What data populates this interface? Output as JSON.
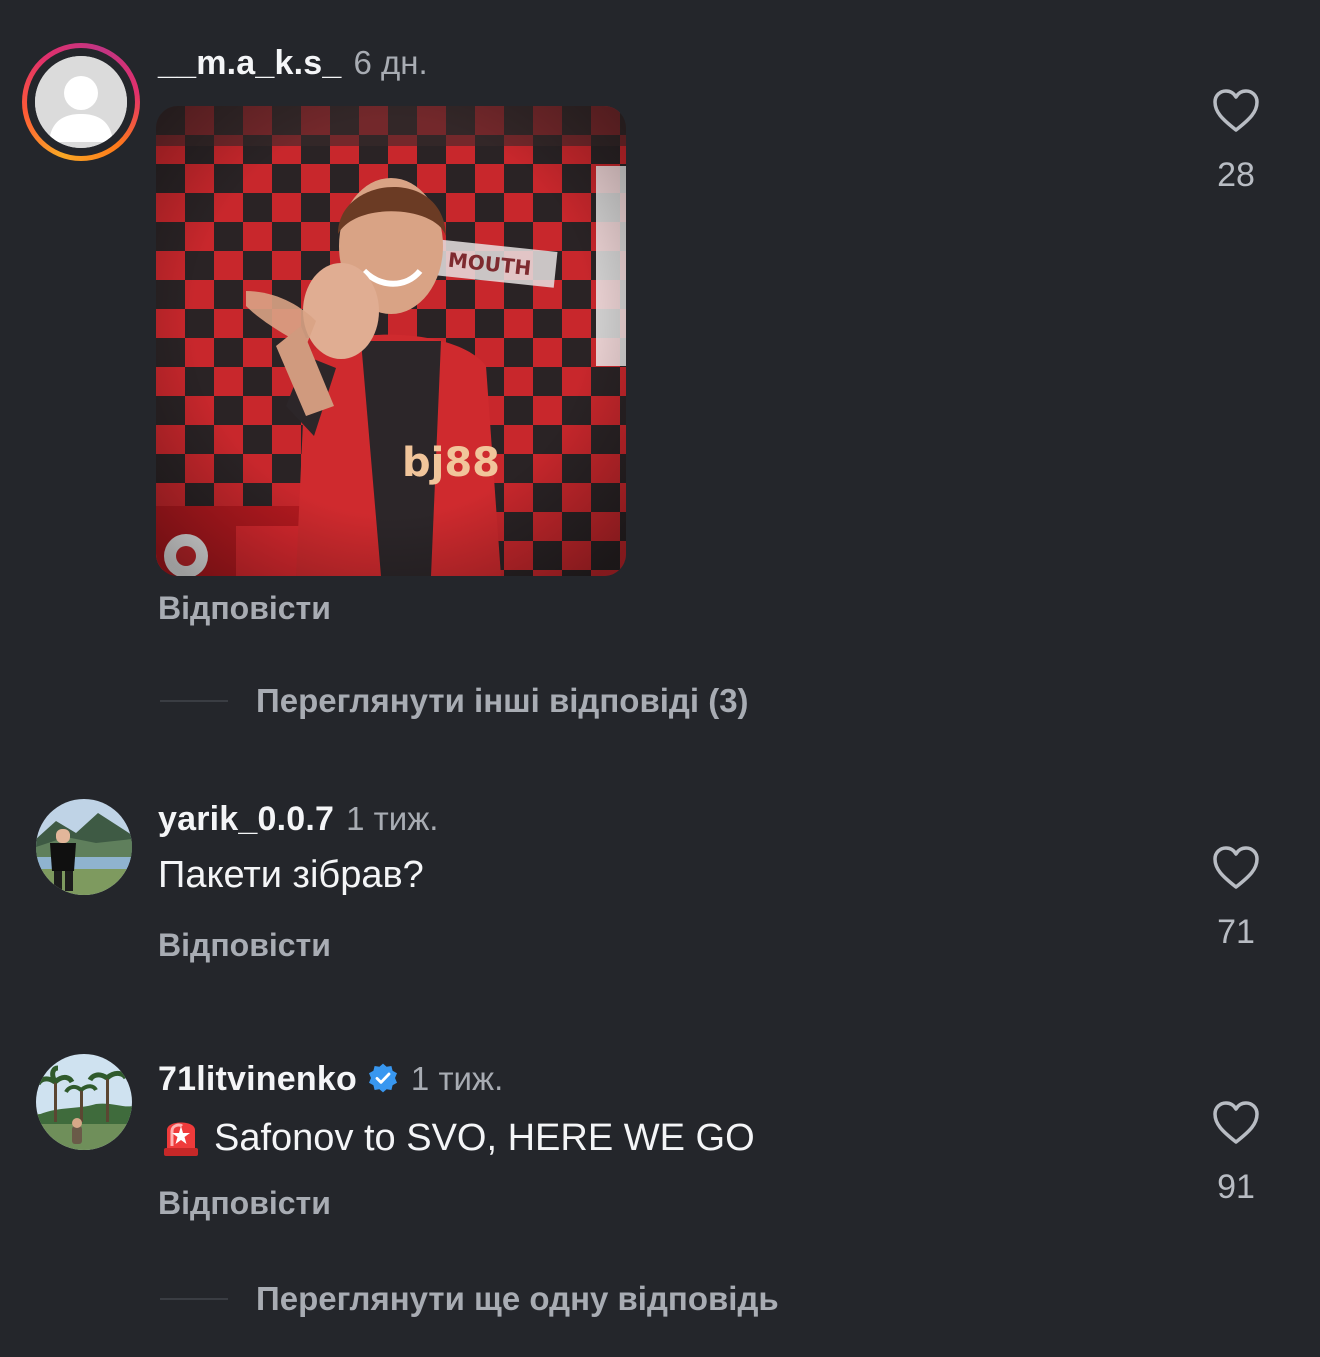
{
  "comments": [
    {
      "username": "__m.a_k.s_",
      "time": "6 дн.",
      "reply_label": "Відповісти",
      "likes": "28",
      "more_replies": "Переглянути інші відповіді (3)",
      "gif": {
        "text": "MOUTH bj88"
      }
    },
    {
      "username": "yarik_0.0.7",
      "time": "1 тиж.",
      "text": "Пакети зібрав?",
      "reply_label": "Відповісти",
      "likes": "71"
    },
    {
      "username": "71litvinenko",
      "verified": true,
      "time": "1 тиж.",
      "emoji": "🚨",
      "text": "Safonov to SVO, HERE WE GO",
      "reply_label": "Відповісти",
      "likes": "91",
      "more_replies": "Переглянути ще одну відповідь"
    }
  ],
  "colors": {
    "background": "#24262b",
    "primary_text": "#f4f5f7",
    "secondary_text": "#a8acb3",
    "verified_blue": "#3897f0",
    "story_ring": [
      "#f9a825",
      "#e1306c",
      "#c13584"
    ]
  },
  "icons": {
    "like": "heart-outline-icon",
    "verified": "verified-badge-icon",
    "emoji": "police-light-emoji"
  }
}
